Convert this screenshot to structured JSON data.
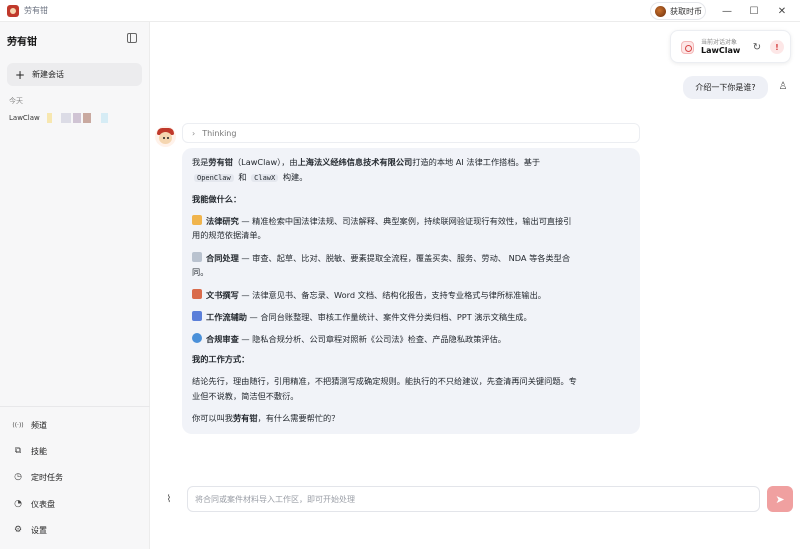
{
  "window": {
    "title": "劳有钳",
    "coin_button": "获取时币",
    "minimize": "—",
    "maximize": "☐",
    "close": "✕"
  },
  "sidebar": {
    "brand": "劳有钳",
    "new_chat": "新建会话",
    "today": "今天",
    "session_label": "LawClaw",
    "nav": [
      {
        "label": "频道",
        "icon": "broadcast-icon",
        "glyph": "((·))"
      },
      {
        "label": "技能",
        "icon": "puzzle-icon",
        "glyph": "⧉"
      },
      {
        "label": "定时任务",
        "icon": "clock-icon",
        "glyph": "◷"
      },
      {
        "label": "仪表盘",
        "icon": "dashboard-icon",
        "glyph": "◔"
      },
      {
        "label": "设置",
        "icon": "gear-icon",
        "glyph": "⚙"
      }
    ]
  },
  "agent": {
    "small_label": "当前对话对象",
    "name": "LawClaw"
  },
  "chat": {
    "user_message": "介绍一下你是谁?",
    "thinking": "Thinking",
    "intro_1": "我是",
    "intro_name": "劳有钳",
    "intro_2": "（LawClaw），由",
    "intro_company": "上海法义经纬信息技术有限公司",
    "intro_3": "打造的本地 AI 法律工作搭档。基于",
    "code_1": "OpenClaw",
    "and": "和",
    "code_2": "ClawX",
    "built": "构建。",
    "what_heading": "我能做什么：",
    "items": [
      {
        "title": "法律研究",
        "desc": " — 精准检索中国法律法规、司法解释、典型案例，持续联网验证现行有效性，输出可直接引",
        "desc2": "用的规范依据清单。",
        "color": "#f0b44c"
      },
      {
        "title": "合同处理",
        "desc": " — 审查、起草、比对、脱敏、要素提取全流程，覆盖买卖、服务、劳动、 NDA 等各类型合",
        "desc2": "同。",
        "color": "#b9c2cf"
      },
      {
        "title": "文书撰写",
        "desc": " — 法律意见书、备忘录、Word 文档、结构化报告，支持专业格式与律所标准输出。",
        "desc2": "",
        "color": "#d96b4b"
      },
      {
        "title": "工作流辅助",
        "desc": " — 合同台账整理、审核工作量统计、案件文件分类归档、PPT 演示文稿生成。",
        "desc2": "",
        "color": "#5b7fd9"
      },
      {
        "title": "合规审查",
        "desc": " — 隐私合规分析、公司章程对照新《公司法》检查、产品隐私政策评估。",
        "desc2": "",
        "color": "#4a90d9"
      }
    ],
    "how_heading": "我的工作方式：",
    "how_1": "结论先行，理由随行，引用精准，不把猜测写成确定规则。能执行的不只给建议，先查清再问关键问题。专",
    "how_2": "业但不说教，简洁但不敷衍。",
    "closing_1": "你可以叫我",
    "closing_name": "劳有钳",
    "closing_2": "，有什么需要帮忙的？"
  },
  "composer": {
    "placeholder": "将合同或案件材料导入工作区，即可开始处理"
  },
  "colors": {
    "accent": "#d64545",
    "send_disabled": "#f0a0a0",
    "bubble": "#f1f3f8"
  }
}
